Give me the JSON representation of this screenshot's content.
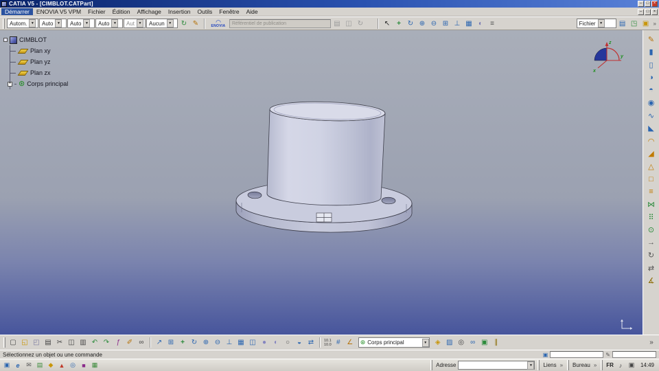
{
  "ui": {
    "dropdown_arrow": "▼",
    "overflow_chevron": "»",
    "minimize_glyph": "–",
    "maximize_glyph": "□",
    "close_glyph": "×",
    "expander_glyph": "+",
    "body_glyph": "⊛",
    "enovia_arc": "◠"
  },
  "titlebar": {
    "title": "CATIA V5 - [CIMBLOT.CATPart]"
  },
  "menubar": {
    "items": [
      "Démarrer",
      "ENOVIA V5 VPM",
      "Fichier",
      "Édition",
      "Affichage",
      "Insertion",
      "Outils",
      "Fenêtre",
      "Aide"
    ]
  },
  "toolbar_top": {
    "combos": [
      "Autom.",
      "Auto",
      "Auto",
      "Auto",
      "Aut",
      "Aucun"
    ],
    "paint_icons": [
      {
        "name": "update-icon",
        "glyph": "↻",
        "style": "color:#2a8a3a"
      },
      {
        "name": "paint-icon",
        "glyph": "✎",
        "style": "color:#b5720a"
      }
    ],
    "enovia_label": "ENOVIA",
    "repository_field": "Référentiel de publication",
    "pub_icons": [
      {
        "name": "pub-open-icon",
        "glyph": "▤",
        "style": "color:#9a9a9a"
      },
      {
        "name": "pub-save-icon",
        "glyph": "◫",
        "style": "color:#9a9a9a"
      },
      {
        "name": "pub-sync-icon",
        "glyph": "↻",
        "style": "color:#9a9a9a"
      }
    ],
    "view_icons": [
      {
        "name": "select-icon",
        "glyph": "↖",
        "style": "color:#222"
      },
      {
        "name": "pan-icon",
        "glyph": "+",
        "style": "color:#2a8a3a;font-weight:bold"
      },
      {
        "name": "rotate-icon",
        "glyph": "↻",
        "style": "color:#2a65b0"
      },
      {
        "name": "zoom-in-icon",
        "glyph": "⊕",
        "style": "color:#2a65b0"
      },
      {
        "name": "zoom-out-icon",
        "glyph": "⊖",
        "style": "color:#2a65b0"
      },
      {
        "name": "fit-all-icon",
        "glyph": "⊞",
        "style": "color:#2a65b0"
      },
      {
        "name": "normal-view-icon",
        "glyph": "⊥",
        "style": "color:#2a65b0"
      },
      {
        "name": "multi-view-icon",
        "glyph": "▦",
        "style": "color:#2a65b0"
      },
      {
        "name": "render-style-icon",
        "glyph": "◐",
        "style": "color:#7a7ab5"
      },
      {
        "name": "options-icon",
        "glyph": "≡",
        "style": "color:#555"
      }
    ],
    "file_combo": "Fichier",
    "file_icons": [
      {
        "name": "notebook-icon",
        "glyph": "▤",
        "style": "color:#2a65b0"
      },
      {
        "name": "publish-icon",
        "glyph": "◳",
        "style": "color:#2a8a3a"
      },
      {
        "name": "folder-icon",
        "glyph": "▣",
        "style": "color:#c8960a"
      }
    ]
  },
  "tree": {
    "root": "CIMBLOT",
    "items": [
      {
        "label": "Plan xy"
      },
      {
        "label": "Plan yz"
      },
      {
        "label": "Plan zx"
      },
      {
        "label": "Corps principal"
      }
    ]
  },
  "compass": {
    "x": "x",
    "y": "y",
    "z": "z"
  },
  "right_toolbar": {
    "icons": [
      {
        "name": "sketcher-icon",
        "glyph": "✎",
        "style": "color:#b5720a"
      },
      {
        "name": "pad-icon",
        "glyph": "▮",
        "style": "color:#2a65b0"
      },
      {
        "name": "pocket-icon",
        "glyph": "▯",
        "style": "color:#2a65b0"
      },
      {
        "name": "shaft-icon",
        "glyph": "◑",
        "style": "color:#2a65b0"
      },
      {
        "name": "groove-icon",
        "glyph": "◓",
        "style": "color:#2a65b0"
      },
      {
        "name": "hole-icon",
        "glyph": "◉",
        "style": "color:#2a65b0"
      },
      {
        "name": "rib-icon",
        "glyph": "∿",
        "style": "color:#2a65b0"
      },
      {
        "name": "stiffener-icon",
        "glyph": "◣",
        "style": "color:#2a65b0"
      },
      {
        "name": "fillet-icon",
        "glyph": "◠",
        "style": "color:#c07a00"
      },
      {
        "name": "chamfer-icon",
        "glyph": "◢",
        "style": "color:#c07a00"
      },
      {
        "name": "draft-icon",
        "glyph": "△",
        "style": "color:#c07a00"
      },
      {
        "name": "shell-icon",
        "glyph": "□",
        "style": "color:#c07a00"
      },
      {
        "name": "thickness-icon",
        "glyph": "≡",
        "style": "color:#c07a00"
      },
      {
        "name": "mirror-icon",
        "glyph": "⋈",
        "style": "color:#2a8a3a"
      },
      {
        "name": "rect-pattern-icon",
        "glyph": "⠿",
        "style": "color:#2a8a3a"
      },
      {
        "name": "circ-pattern-icon",
        "glyph": "⊙",
        "style": "color:#2a8a3a"
      },
      {
        "name": "translate-icon",
        "glyph": "→",
        "style": "color:#555"
      },
      {
        "name": "rotate-body-icon",
        "glyph": "↻",
        "style": "color:#555"
      },
      {
        "name": "symmetry-icon",
        "glyph": "⇄",
        "style": "color:#555"
      },
      {
        "name": "measure-icon",
        "glyph": "∡",
        "style": "color:#8a6a00"
      }
    ]
  },
  "toolbar_bottom": {
    "file_icons": [
      {
        "name": "new-icon",
        "glyph": "▢",
        "style": "color:#444"
      },
      {
        "name": "open-icon",
        "glyph": "◱",
        "style": "color:#c8960a"
      },
      {
        "name": "save-icon",
        "glyph": "◰",
        "style": "color:#7a7aa0"
      },
      {
        "name": "print-icon",
        "glyph": "▤",
        "style": "color:#444"
      },
      {
        "name": "cut-icon",
        "glyph": "✂",
        "style": "color:#444"
      },
      {
        "name": "copy-icon",
        "glyph": "◫",
        "style": "color:#444"
      },
      {
        "name": "paste-icon",
        "glyph": "▥",
        "style": "color:#444"
      },
      {
        "name": "undo-icon",
        "glyph": "↶",
        "style": "color:#2a8a3a"
      },
      {
        "name": "redo-icon",
        "glyph": "↷",
        "style": "color:#2a8a3a"
      },
      {
        "name": "fx-icon",
        "glyph": "ƒ",
        "style": "color:#8a2a8a;font-style:italic"
      },
      {
        "name": "wand-icon",
        "glyph": "✐",
        "style": "color:#b5720a"
      },
      {
        "name": "link-icon",
        "glyph": "∞",
        "style": "color:#444"
      }
    ],
    "view_icons": [
      {
        "name": "fly-icon",
        "glyph": "↗",
        "style": "color:#2a65b0"
      },
      {
        "name": "fit-all-icon",
        "glyph": "⊞",
        "style": "color:#2a65b0"
      },
      {
        "name": "pan-icon",
        "glyph": "+",
        "style": "color:#2a8a3a;font-weight:bold"
      },
      {
        "name": "rotate-icon",
        "glyph": "↻",
        "style": "color:#2a65b0"
      },
      {
        "name": "zoom-in-icon",
        "glyph": "⊕",
        "style": "color:#2a65b0"
      },
      {
        "name": "zoom-out-icon",
        "glyph": "⊖",
        "style": "color:#2a65b0"
      },
      {
        "name": "normal-view-icon",
        "glyph": "⊥",
        "style": "color:#2a65b0"
      },
      {
        "name": "iso-view-icon",
        "glyph": "▦",
        "style": "color:#2a65b0"
      },
      {
        "name": "quick-view-icon",
        "glyph": "◫",
        "style": "color:#2a65b0"
      },
      {
        "name": "shaded-icon",
        "glyph": "●",
        "style": "color:#8585c0"
      },
      {
        "name": "shaded-edges-icon",
        "glyph": "◐",
        "style": "color:#8585c0"
      },
      {
        "name": "wireframe-icon",
        "glyph": "○",
        "style": "color:#555"
      },
      {
        "name": "hide-show-icon",
        "glyph": "◒",
        "style": "color:#2a65b0"
      },
      {
        "name": "swap-visible-icon",
        "glyph": "⇄",
        "style": "color:#2a65b0"
      }
    ],
    "grid_top": "10.1",
    "grid_bottom": "10.0",
    "snap_icons": [
      {
        "name": "grid-icon",
        "glyph": "#",
        "style": "color:#2a65b0"
      },
      {
        "name": "snap-angle-icon",
        "glyph": "∠",
        "style": "color:#b5720a"
      }
    ],
    "body_combo": "Corps principal",
    "right_icons": [
      {
        "name": "catalog-icon",
        "glyph": "◈",
        "style": "color:#c8960a"
      },
      {
        "name": "paint-bucket-icon",
        "glyph": "▨",
        "style": "color:#2a65b0"
      },
      {
        "name": "search-icon",
        "glyph": "◎",
        "style": "color:#444"
      },
      {
        "name": "link-manager-icon",
        "glyph": "∞",
        "style": "color:#2a65b0"
      },
      {
        "name": "powercopy-icon",
        "glyph": "▣",
        "style": "color:#2a8a3a"
      },
      {
        "name": "measure-between-icon",
        "glyph": "∥",
        "style": "color:#8a6a00"
      },
      {
        "name": "toolbar-overflow-icon",
        "glyph": "»",
        "style": "color:#444"
      }
    ]
  },
  "statusbar": {
    "message": "Sélectionnez un objet ou une commande",
    "field_icons": [
      {
        "name": "command-icon",
        "glyph": "▣",
        "style": "color:#2a65b0"
      },
      {
        "name": "edit-icon",
        "glyph": "✎",
        "style": "color:#555"
      }
    ]
  },
  "taskbar": {
    "quick_icons": [
      {
        "name": "app-icon-1",
        "glyph": "▣",
        "style": "color:#2a65b0"
      },
      {
        "name": "ie-icon",
        "glyph": "e",
        "style": "color:#2a65b0;font-style:italic;font-weight:bold"
      },
      {
        "name": "mail-icon",
        "glyph": "✉",
        "style": "color:#555"
      },
      {
        "name": "app-icon-2",
        "glyph": "▤",
        "style": "color:#3a8a3a"
      },
      {
        "name": "app-icon-3",
        "glyph": "◆",
        "style": "color:#c8960a"
      },
      {
        "name": "acrobat-icon",
        "glyph": "▲",
        "style": "color:#c03a2a"
      },
      {
        "name": "app-icon-4",
        "glyph": "◎",
        "style": "color:#2a65b0"
      },
      {
        "name": "app-icon-5",
        "glyph": "■",
        "style": "color:#8a2a8a"
      },
      {
        "name": "app-icon-6",
        "glyph": "▦",
        "style": "color:#3a8a3a"
      }
    ],
    "address_label": "Adresse",
    "links_label": "Liens",
    "desktop_label": "Bureau",
    "language": "FR",
    "tray_icons": [
      {
        "name": "volume-icon",
        "glyph": "♪",
        "style": "color:#444"
      },
      {
        "name": "network-icon",
        "glyph": "▣",
        "style": "color:#444"
      }
    ],
    "time": "14:49"
  }
}
